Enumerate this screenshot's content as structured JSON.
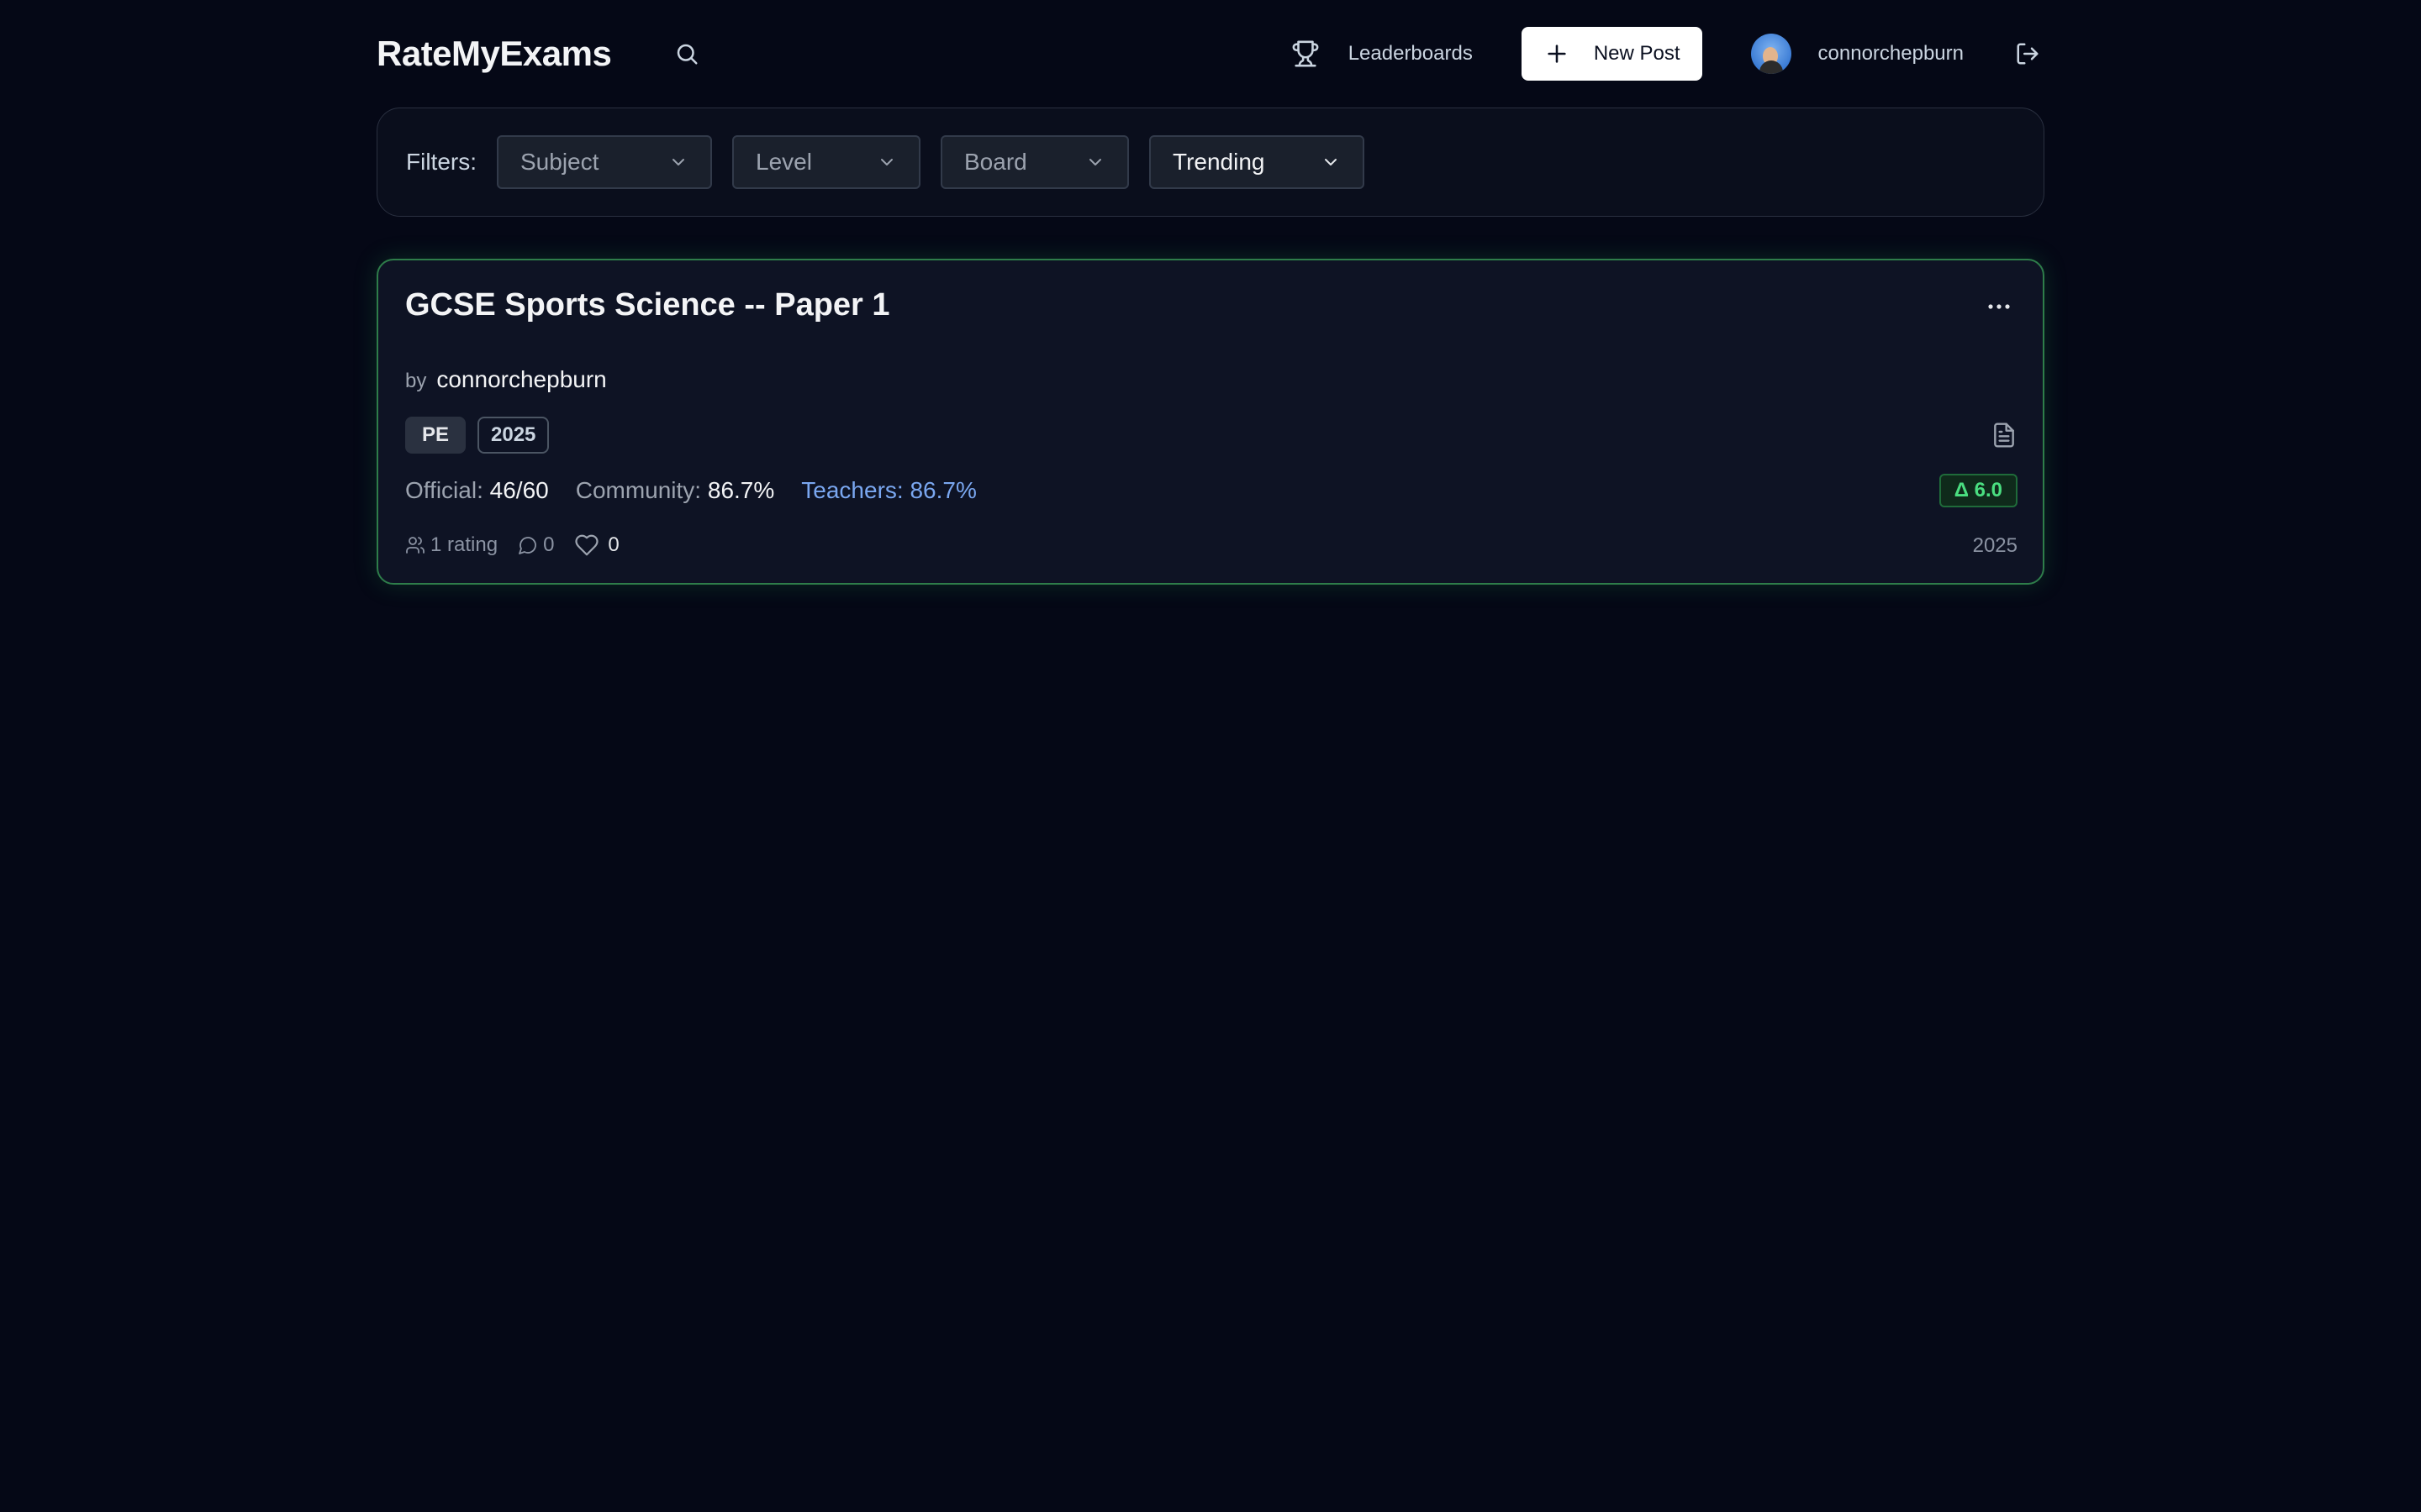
{
  "header": {
    "brand": "RateMyExams",
    "leaderboards_label": "Leaderboards",
    "new_post_label": "New Post",
    "username": "connorchepburn"
  },
  "filters": {
    "label": "Filters:",
    "subject": "Subject",
    "level": "Level",
    "board": "Board",
    "sort": "Trending"
  },
  "post": {
    "title": "GCSE Sports Science -- Paper 1",
    "by_label": "by",
    "author": "connorchepburn",
    "tag_subject": "PE",
    "tag_year": "2025",
    "official_label": "Official:",
    "official_value": "46/60",
    "community_label": "Community:",
    "community_value": "86.7%",
    "teachers_label": "Teachers:",
    "teachers_value": "86.7%",
    "delta": "Δ 6.0",
    "ratings": "1 rating",
    "comments": "0",
    "likes": "0",
    "year": "2025"
  },
  "colors": {
    "background": "#050816",
    "accent_green": "#4ade80",
    "card_border": "#2e7d4a",
    "teacher_blue": "#7aa7f0"
  },
  "icons": {
    "search": "search-icon",
    "trophy": "trophy-icon",
    "plus": "plus-icon",
    "logout": "logout-icon",
    "chevron": "chevron-down-icon",
    "more": "more-horizontal-icon",
    "document": "document-icon",
    "users": "users-icon",
    "comment": "comment-icon",
    "heart": "heart-icon"
  }
}
